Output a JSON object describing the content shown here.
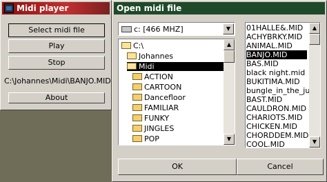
{
  "midi_player": {
    "title": "Midi player",
    "select_label": "Select midi file",
    "play_label": "Play",
    "stop_label": "Stop",
    "current_file": "C:\\Johannes\\Midi\\BANJO.MID",
    "about_label": "About"
  },
  "dialog": {
    "title": "Open midi file",
    "drive": "c: [466 MHZ]",
    "dirs": [
      "C:\\",
      "Johannes",
      "Midi",
      "ACTION",
      "CARTOON",
      "Dancefloor",
      "FAMILIAR",
      "FUNKY",
      "JINGLES",
      "POP"
    ],
    "selected_dir_index": 2,
    "files": [
      "01HALLE&.MID",
      "ACHYBRKY.MID",
      "ANIMAL.MID",
      "BANJO.MID",
      "BAS.MID",
      "black night.mid",
      "BUKITIMA.MID",
      "bungle_in_the_jungle",
      "BAST.MID",
      "CAULDRON.MID",
      "CHARIOTS.MID",
      "CHICKEN.MID",
      "CHORDDEM.MID",
      "COOL.MID"
    ],
    "selected_file_index": 3,
    "ok_label": "OK",
    "cancel_label": "Cancel",
    "scroll_up_glyph": "▲",
    "scroll_down_glyph": "▼",
    "dropdown_glyph": "▼"
  },
  "colors": {
    "desktop": "#6f6c58",
    "title_active": "#8a1010",
    "title_dialog": "#1f4a2a",
    "selection": "#000000"
  }
}
